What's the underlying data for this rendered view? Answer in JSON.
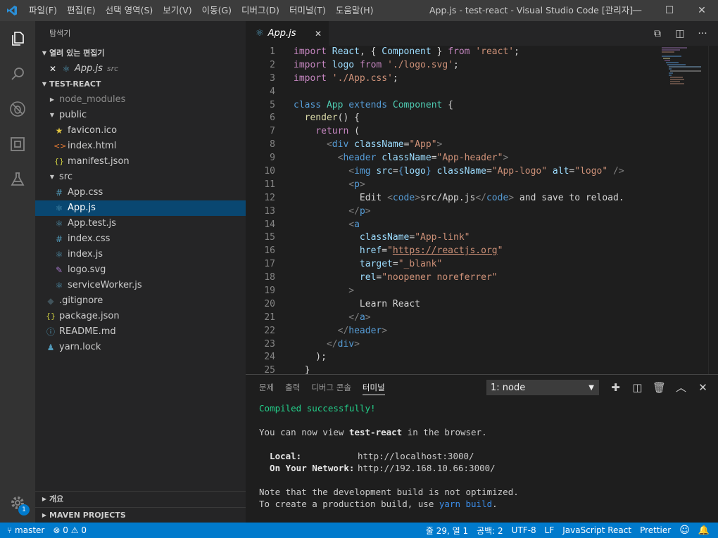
{
  "titlebar": {
    "menus": [
      "파일(F)",
      "편집(E)",
      "선택 영역(S)",
      "보기(V)",
      "이동(G)",
      "디버그(D)",
      "터미널(T)",
      "도움말(H)"
    ],
    "title": "App.js - test-react - Visual Studio Code [관리자]",
    "minimize": "—",
    "maximize": "☐",
    "close": "✕"
  },
  "sidebar": {
    "title": "탐색기",
    "open_editors": {
      "header": "열려 있는 편집기",
      "file": "App.js",
      "folder": "src"
    },
    "project": "TEST-REACT",
    "tree": [
      {
        "label": "node_modules",
        "kind": "folder-collapsed",
        "depth": 1
      },
      {
        "label": "public",
        "kind": "folder-open",
        "depth": 1
      },
      {
        "label": "favicon.ico",
        "kind": "star",
        "depth": 2
      },
      {
        "label": "index.html",
        "kind": "html",
        "depth": 2
      },
      {
        "label": "manifest.json",
        "kind": "json",
        "depth": 2
      },
      {
        "label": "src",
        "kind": "folder-open",
        "depth": 1
      },
      {
        "label": "App.css",
        "kind": "css",
        "depth": 2
      },
      {
        "label": "App.js",
        "kind": "react",
        "depth": 2,
        "selected": true
      },
      {
        "label": "App.test.js",
        "kind": "react",
        "depth": 2
      },
      {
        "label": "index.css",
        "kind": "css",
        "depth": 2
      },
      {
        "label": "index.js",
        "kind": "react",
        "depth": 2
      },
      {
        "label": "logo.svg",
        "kind": "svg",
        "depth": 2
      },
      {
        "label": "serviceWorker.js",
        "kind": "react",
        "depth": 2
      },
      {
        "label": ".gitignore",
        "kind": "git",
        "depth": 1
      },
      {
        "label": "package.json",
        "kind": "json",
        "depth": 1
      },
      {
        "label": "README.md",
        "kind": "info",
        "depth": 1
      },
      {
        "label": "yarn.lock",
        "kind": "yarn",
        "depth": 1
      }
    ],
    "outline": "개요",
    "maven": "MAVEN PROJECTS"
  },
  "activity": {
    "badge": "1"
  },
  "editor": {
    "tab": "App.js",
    "line_numbers": [
      "1",
      "2",
      "3",
      "4",
      "5",
      "6",
      "7",
      "8",
      "9",
      "10",
      "11",
      "12",
      "13",
      "14",
      "15",
      "16",
      "17",
      "18",
      "19",
      "20",
      "21",
      "22",
      "23",
      "24",
      "25"
    ]
  },
  "panel": {
    "tabs": [
      "문제",
      "출력",
      "디버그 콘솔",
      "터미널"
    ],
    "active_tab": "터미널",
    "terminal_select": "1: node",
    "terminal": {
      "compiled": "Compiled successfully!",
      "view_prefix": "You can now view ",
      "app_name": "test-react",
      "view_suffix": " in the browser.",
      "local_label": "  Local:",
      "local_url": "http://localhost:3000/",
      "network_label": "  On Your Network:",
      "network_url": "http://192.168.10.66:3000/",
      "note": "Note that the development build is not optimized.",
      "prod_prefix": "To create a production build, use ",
      "prod_cmd": "yarn build",
      "prod_suffix": "."
    }
  },
  "statusbar": {
    "branch": "master",
    "errors": "0",
    "warnings": "0",
    "position": "줄 29, 열 1",
    "spaces": "공백: 2",
    "encoding": "UTF-8",
    "eol": "LF",
    "language": "JavaScript React",
    "formatter": "Prettier"
  },
  "colors": {
    "accent": "#007acc",
    "selection": "#094771",
    "titlebar": "#3c3c3c",
    "activitybar": "#333333",
    "sidebar": "#252526",
    "editor": "#1e1e1e"
  }
}
